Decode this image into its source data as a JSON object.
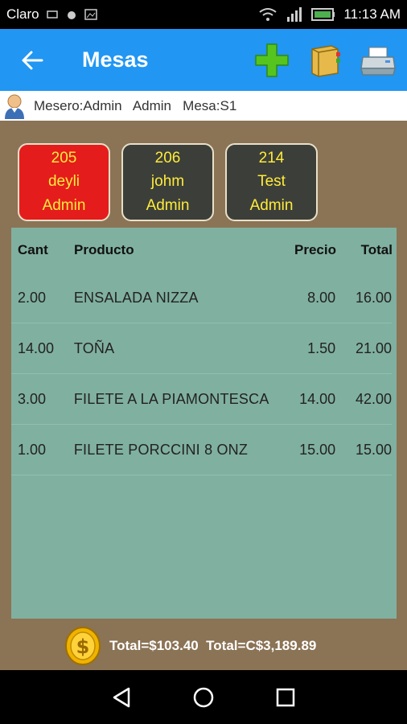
{
  "status_bar": {
    "carrier": "Claro",
    "time": "11:13 AM"
  },
  "app_bar": {
    "title": "Mesas",
    "back_icon": "arrow-left-icon",
    "add_icon": "add-plus-icon",
    "book_icon": "notebook-icon",
    "print_icon": "printer-icon",
    "color": "#2196f3"
  },
  "info": {
    "text": "Mesero:Admin   Admin   Mesa:S1"
  },
  "tables": [
    {
      "number": "205",
      "name": "deyli",
      "waiter": "Admin",
      "active": true
    },
    {
      "number": "206",
      "name": "johm",
      "waiter": "Admin",
      "active": false
    },
    {
      "number": "214",
      "name": "Test",
      "waiter": "Admin",
      "active": false
    }
  ],
  "order": {
    "headers": {
      "cant": "Cant",
      "producto": "Producto",
      "precio": "Precio",
      "total": "Total"
    },
    "rows": [
      {
        "cant": "2.00",
        "producto": "ENSALADA NIZZA",
        "precio": "8.00",
        "total": "16.00"
      },
      {
        "cant": "14.00",
        "producto": "TOÑA",
        "precio": "1.50",
        "total": "21.00"
      },
      {
        "cant": "3.00",
        "producto": "FILETE A LA PIAMONTESCA",
        "precio": "14.00",
        "total": "42.00"
      },
      {
        "cant": "1.00",
        "producto": "FILETE PORCCINI 8 ONZ",
        "precio": "15.00",
        "total": "15.00"
      }
    ]
  },
  "footer": {
    "totals_text": "Total=$103.40  Total=C$3,189.89",
    "coin_icon": "dollar-coin-icon"
  },
  "nav": {
    "back_icon": "nav-back-icon",
    "home_icon": "nav-home-icon",
    "recents_icon": "nav-recents-icon"
  }
}
